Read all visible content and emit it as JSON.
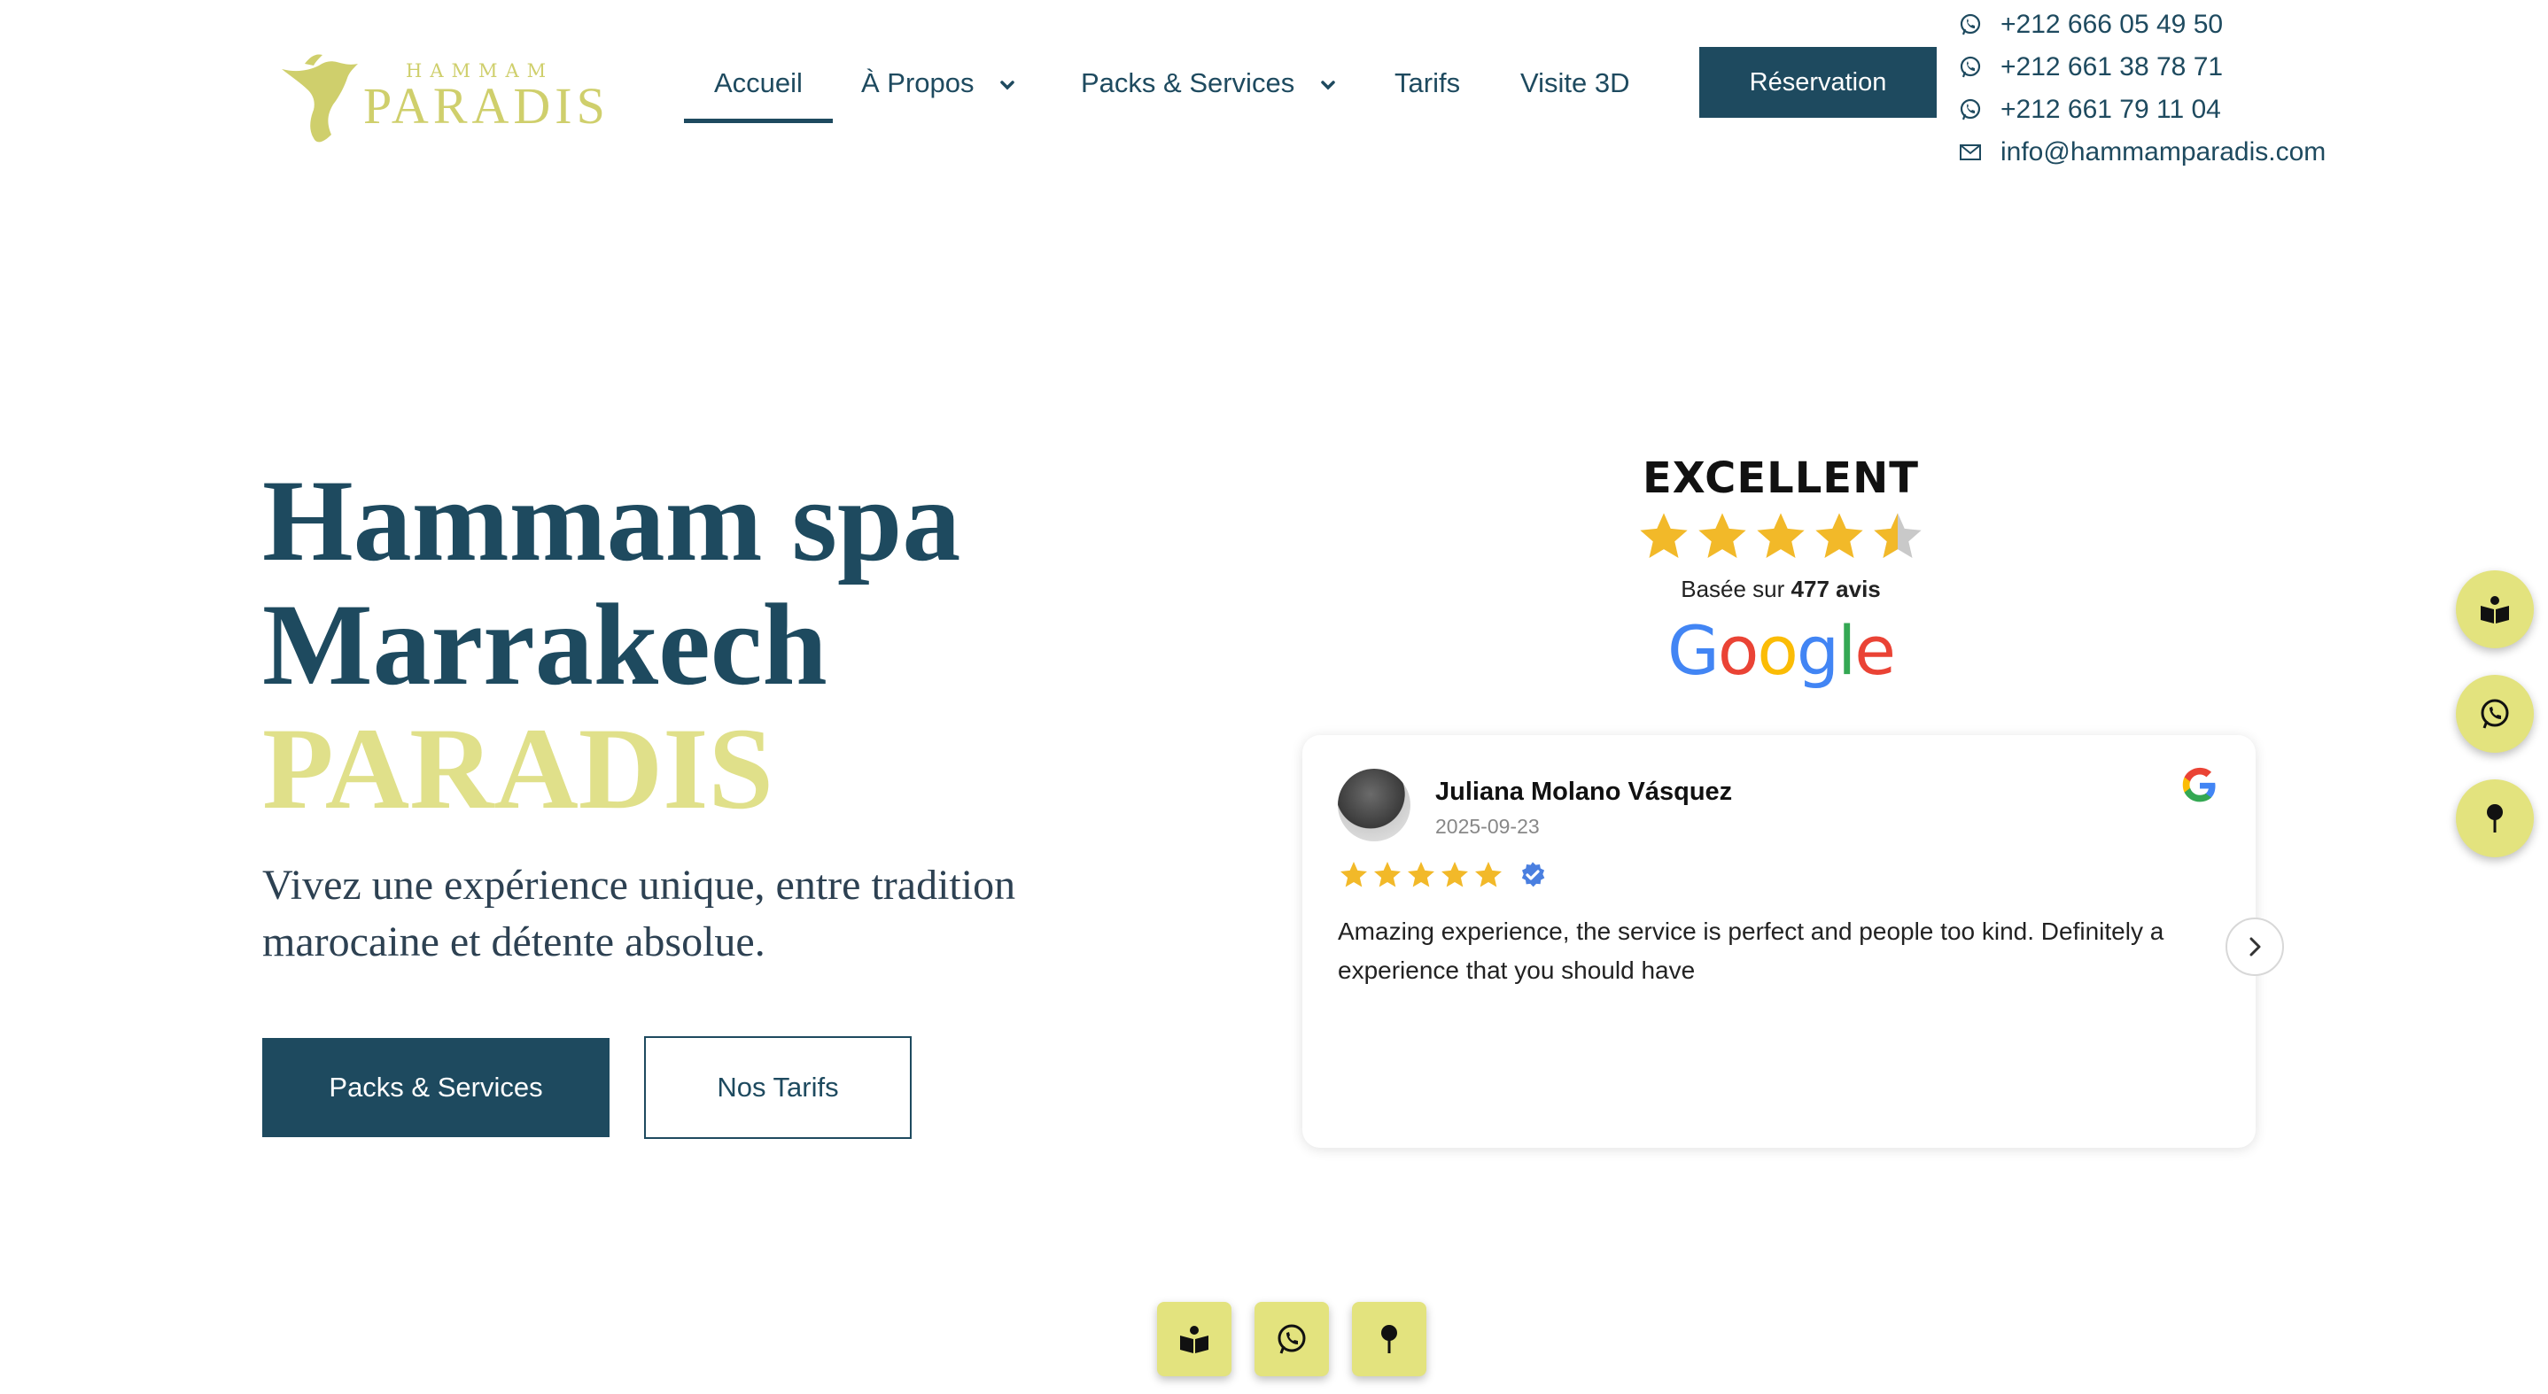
{
  "logo": {
    "top_text": "HAMMAM",
    "main_text": "PARADIS",
    "color": "#cfcf6c"
  },
  "nav": {
    "items": [
      {
        "label": "Accueil",
        "active": true
      },
      {
        "label": "À Propos",
        "dropdown": true
      },
      {
        "label": "Packs & Services",
        "dropdown": true
      },
      {
        "label": "Tarifs"
      },
      {
        "label": "Visite 3D"
      }
    ],
    "cta": "Réservation"
  },
  "contacts": {
    "phones": [
      "+212 666 05 49 50",
      "+212 661 38 78 71",
      "+212 661 79 11 04"
    ],
    "email": "info@hammamparadis.com",
    "phone_icon": "whatsapp-icon",
    "email_icon": "mail-icon"
  },
  "hero": {
    "title_line1": "Hammam spa",
    "title_line2": "Marrakech",
    "title_accent": "PARADIS",
    "subtitle": "Vivez une expérience unique, entre tradition marocaine et détente absolue.",
    "primary_button": "Packs & Services",
    "secondary_button": "Nos Tarifs"
  },
  "rating": {
    "label": "EXCELLENT",
    "stars": 4.5,
    "based_prefix": "Basée sur",
    "review_count": "477 avis",
    "provider": "Google"
  },
  "review": {
    "name": "Juliana Molano Vásquez",
    "date": "2025-09-23",
    "stars": 5,
    "verified": true,
    "text": "Amazing experience, the service is perfect and people too kind. Definitely a experience that you should have"
  },
  "fabs": [
    {
      "icon": "book-icon"
    },
    {
      "icon": "whatsapp-icon"
    },
    {
      "icon": "map-pin-icon"
    }
  ],
  "colors": {
    "primary": "#1e4a5f",
    "accent": "#e0e08a",
    "fab": "#e3e37e",
    "star": "#f2b929"
  }
}
